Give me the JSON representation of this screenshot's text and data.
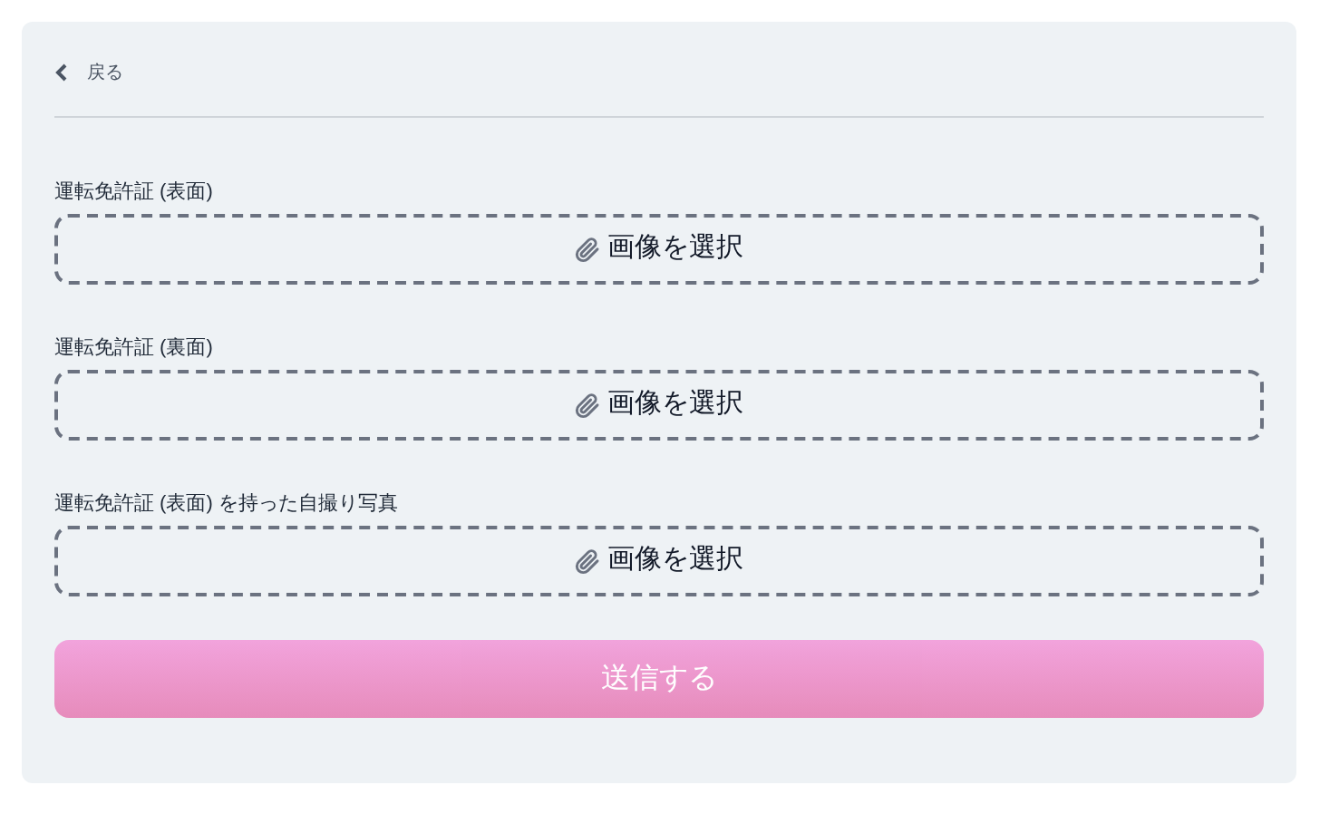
{
  "back_link": {
    "label": "戻る"
  },
  "uploads": [
    {
      "label": "運転免許証 (表面)",
      "button": "画像を選択"
    },
    {
      "label": "運転免許証 (裏面)",
      "button": "画像を選択"
    },
    {
      "label": "運転免許証 (表面) を持った自撮り写真",
      "button": "画像を選択"
    }
  ],
  "submit": {
    "label": "送信する",
    "disabled": true
  }
}
